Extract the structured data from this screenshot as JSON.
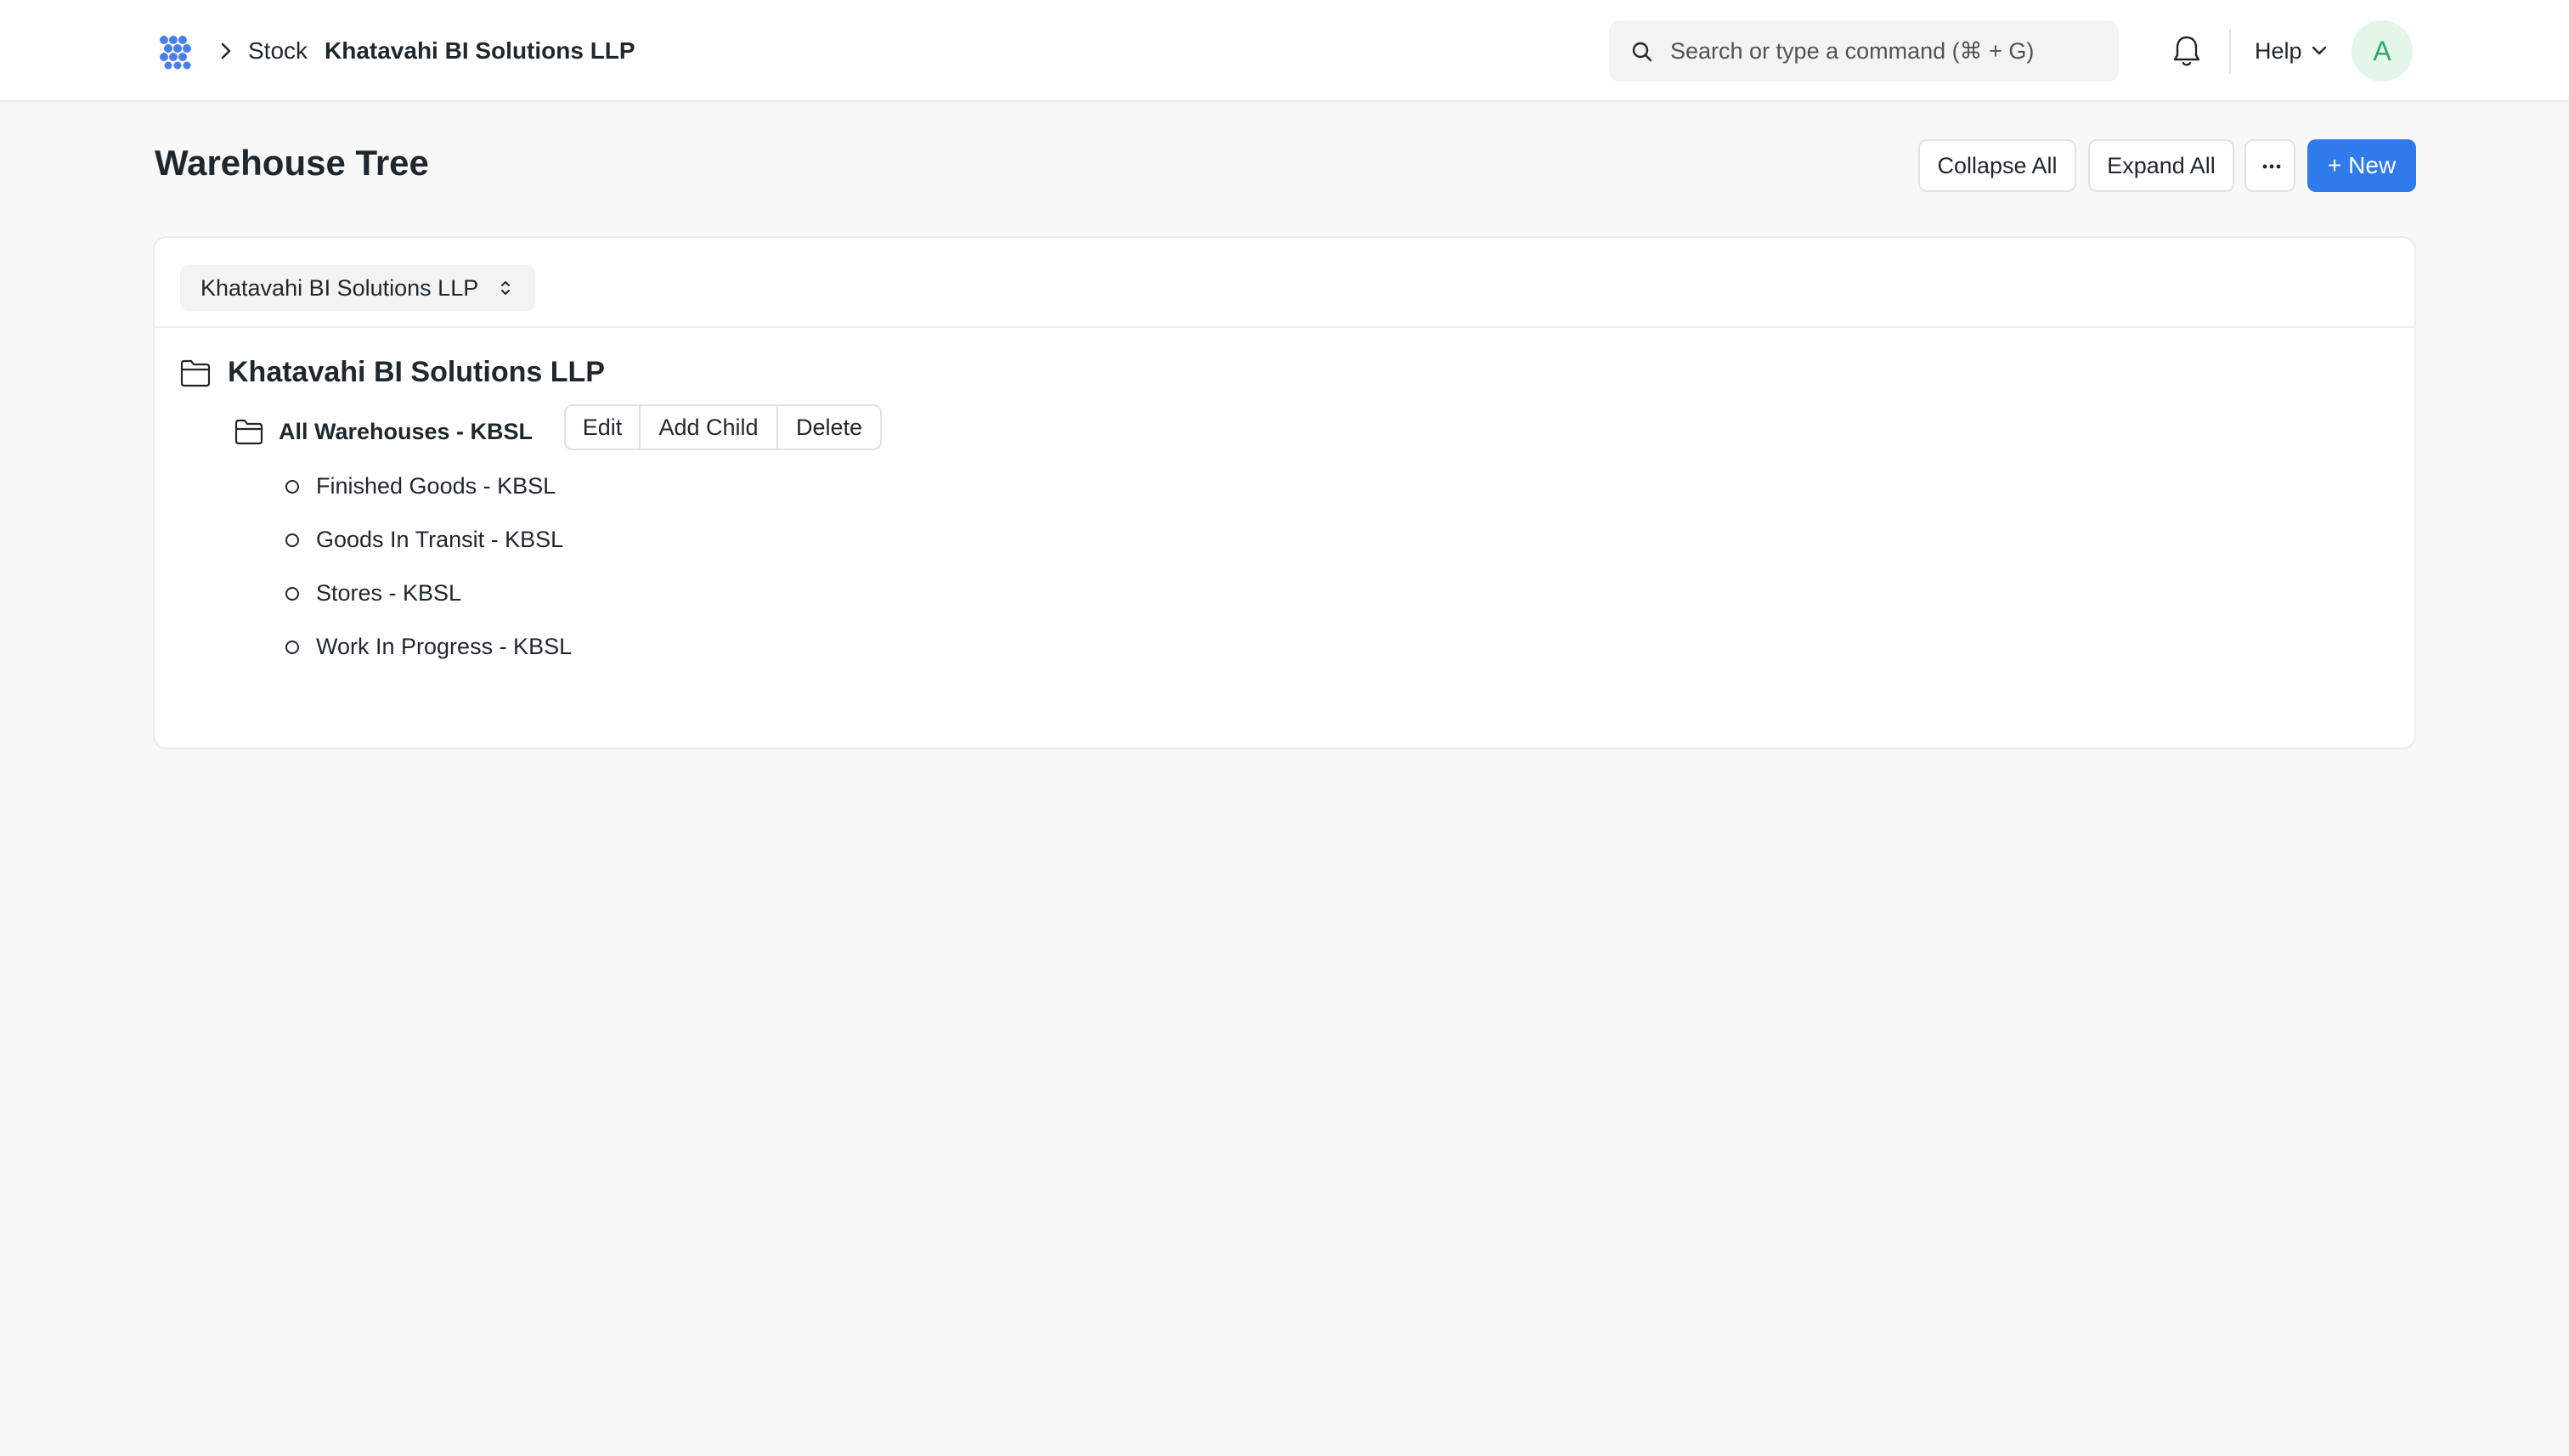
{
  "navbar": {
    "breadcrumb": {
      "module": "Stock",
      "current": "Khatavahi BI Solutions LLP"
    },
    "search": {
      "placeholder": "Search or type a command (⌘ + G)"
    },
    "help_label": "Help",
    "avatar_initial": "A"
  },
  "page": {
    "title": "Warehouse Tree",
    "actions": {
      "collapse_all": "Collapse All",
      "expand_all": "Expand All",
      "new_plus": "+",
      "new_label": "New"
    }
  },
  "filter": {
    "company": "Khatavahi BI Solutions LLP"
  },
  "tree": {
    "root": {
      "label": "Khatavahi BI Solutions LLP",
      "child": {
        "label": "All Warehouses - KBSL",
        "actions": [
          "Edit",
          "Add Child",
          "Delete"
        ],
        "leaves": [
          "Finished Goods - KBSL",
          "Goods In Transit - KBSL",
          "Stores - KBSL",
          "Work In Progress - KBSL"
        ]
      }
    }
  },
  "colors": {
    "primary": "#2f7bec",
    "background": "#f8f8f8",
    "text": "#1f272e",
    "avatar_bg": "#e4f5e9",
    "avatar_text": "#30a66d"
  }
}
